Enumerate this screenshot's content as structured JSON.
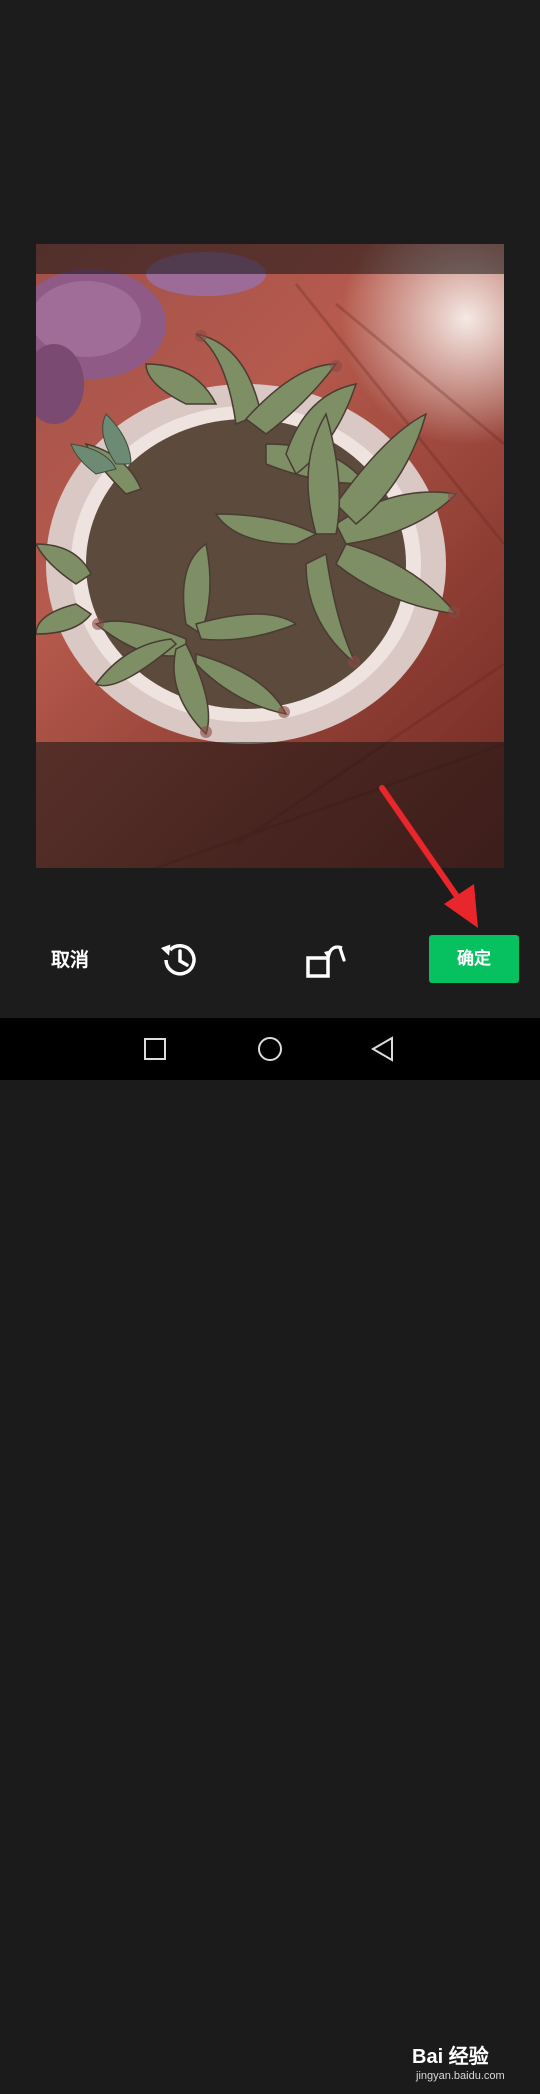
{
  "toolbar": {
    "cancel_label": "取消",
    "confirm_label": "确定",
    "history_icon": "history-icon",
    "rotate_icon": "rotate-icon"
  },
  "photo": {
    "subject": "succulent-plant-photo"
  },
  "navbar": {
    "recent_icon": "square-recent-icon",
    "home_icon": "circle-home-icon",
    "back_icon": "triangle-back-icon"
  },
  "watermark": {
    "logo_text": "Bai 经验",
    "url_text": "jingyan.baidu.com"
  },
  "colors": {
    "confirm_green": "#07c160",
    "annotation_red": "#e8262b",
    "background": "#1c1c1c"
  }
}
